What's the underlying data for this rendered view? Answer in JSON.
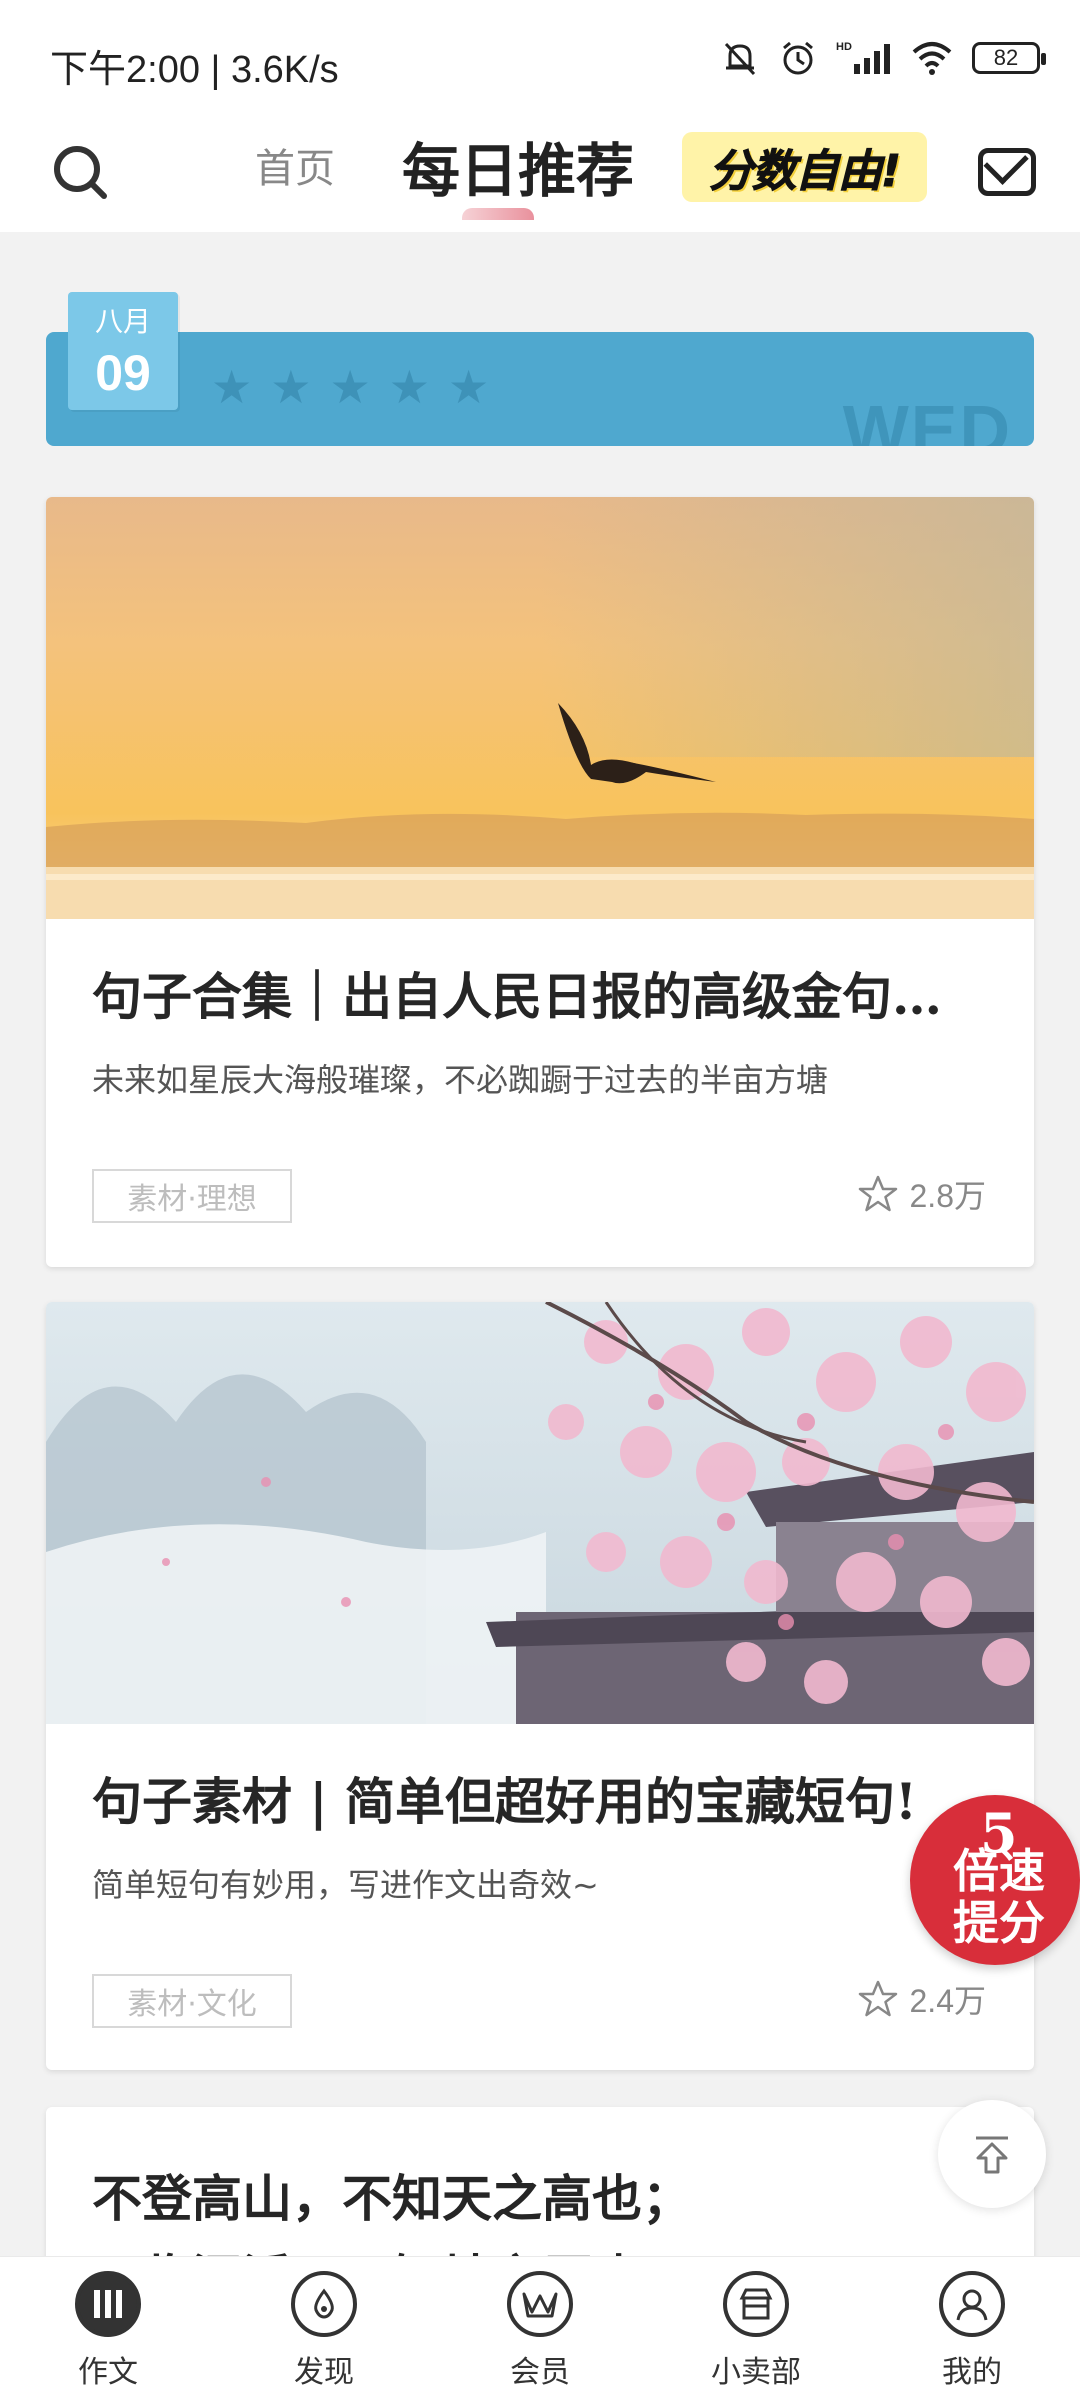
{
  "status_bar": {
    "time": "下午2:00 | 3.6K/s",
    "battery": "82",
    "icons": [
      "mute-bell-icon",
      "alarm-icon",
      "hd-signal-icon",
      "wifi-icon",
      "battery-icon"
    ]
  },
  "header": {
    "tab_home": "首页",
    "tab_daily": "每日推荐",
    "promo": "分数自由!"
  },
  "date_banner": {
    "month": "八月",
    "day": "09",
    "weekday": "WED",
    "stars": 5
  },
  "cards": [
    {
      "title": "句子合集｜出自人民日报的高级金句…",
      "subtitle": "未来如星辰大海般璀璨，不必踟蹰于过去的半亩方塘",
      "tag": "素材·理想",
      "favorites": "2.8万"
    },
    {
      "title": "句子素材 | 简单但超好用的宝藏短句!",
      "subtitle": "简单短句有妙用，写进作文出奇效~",
      "tag": "素材·文化",
      "favorites": "2.4万"
    }
  ],
  "poem": {
    "line1": "不登高山，不知天之高也；",
    "line2": "不临深溪，不知地之厚也。"
  },
  "boost_badge": {
    "number": "5",
    "text": "倍速提分"
  },
  "bottom_nav": [
    {
      "label": "作文",
      "icon": "essay-icon",
      "active": true
    },
    {
      "label": "发现",
      "icon": "discover-icon",
      "active": false
    },
    {
      "label": "会员",
      "icon": "member-crown-icon",
      "active": false
    },
    {
      "label": "小卖部",
      "icon": "shop-icon",
      "active": false
    },
    {
      "label": "我的",
      "icon": "profile-icon",
      "active": false
    }
  ]
}
